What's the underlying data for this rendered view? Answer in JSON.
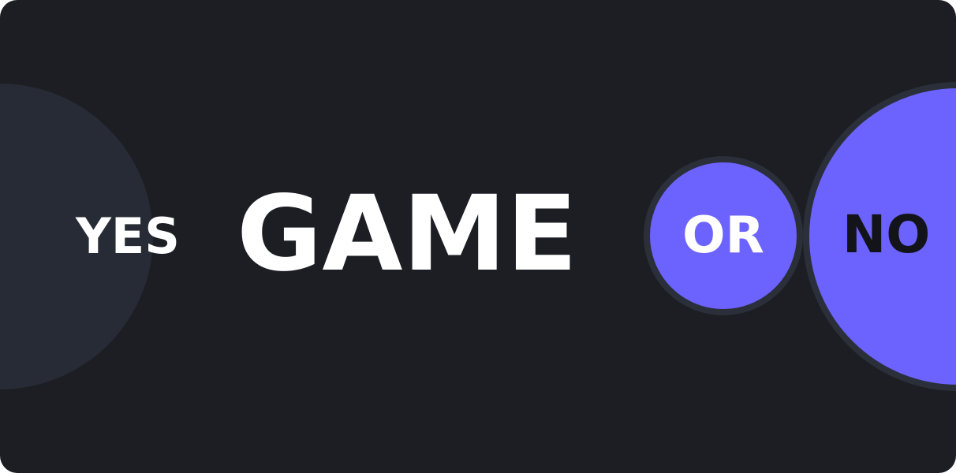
{
  "banner": {
    "yes_label": "YES",
    "title": "GAME",
    "or_label": "OR",
    "no_label": "NO"
  },
  "colors": {
    "background": "#1c1e23",
    "yes_circle": "#262b35",
    "accent": "#6c63ff",
    "ring": "#2a2f3a",
    "text_light": "#ffffff",
    "text_dark": "#13141a"
  }
}
